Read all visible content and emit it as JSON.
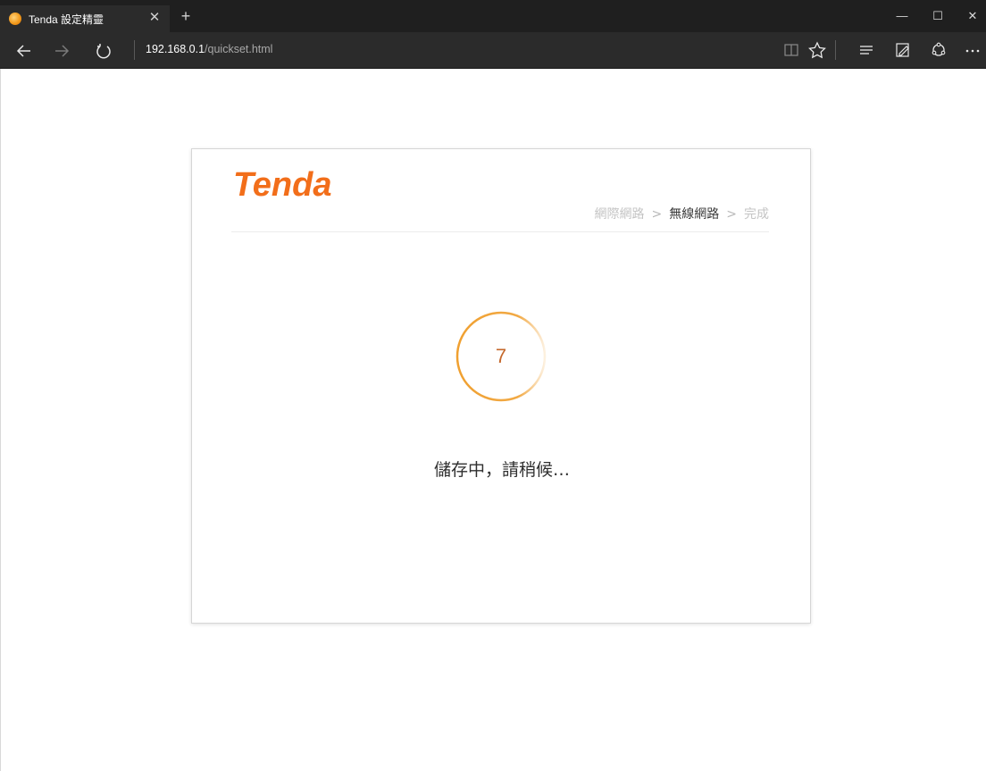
{
  "browser": {
    "tab_title": "Tenda 設定精靈",
    "address_host": "192.168.0.1",
    "address_path": "/quickset.html"
  },
  "icons": {
    "back": "arrow-left-icon",
    "forward": "arrow-right-icon",
    "refresh": "refresh-icon",
    "reading_view": "book-icon",
    "favorite": "star-icon",
    "hub": "hub-icon",
    "web_note": "pen-icon",
    "share": "share-icon",
    "more": "more-icon"
  },
  "brand": {
    "logo_text": "Tenda",
    "accent_color": "#f26e1a",
    "spinner_color": "#f0a030"
  },
  "wizard": {
    "steps": [
      {
        "label": "網際網路",
        "state": "done"
      },
      {
        "label": "無線網路",
        "state": "active"
      },
      {
        "label": "完成",
        "state": "pending"
      }
    ],
    "separator": ">",
    "countdown": "7",
    "status_text": "儲存中，請稍候…"
  }
}
